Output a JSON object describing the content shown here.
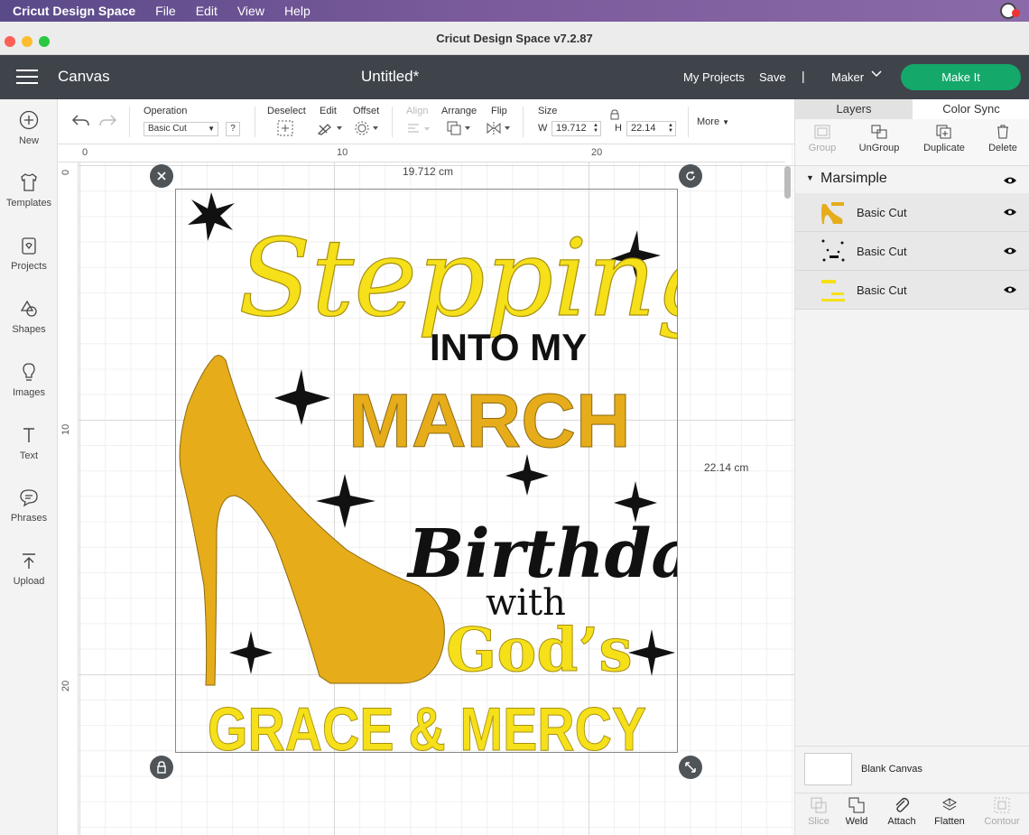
{
  "menubar": {
    "app_name": "Cricut Design Space",
    "items": [
      "File",
      "Edit",
      "View",
      "Help"
    ]
  },
  "window": {
    "title": "Cricut Design Space  v7.2.87"
  },
  "header": {
    "section": "Canvas",
    "doc_title": "Untitled*",
    "my_projects": "My Projects",
    "save": "Save",
    "separator": "|",
    "machine": "Maker",
    "make_it": "Make It"
  },
  "sidebar": {
    "items": [
      {
        "label": "New",
        "icon": "plus-circle-icon"
      },
      {
        "label": "Templates",
        "icon": "shirt-icon"
      },
      {
        "label": "Projects",
        "icon": "projects-icon"
      },
      {
        "label": "Shapes",
        "icon": "shapes-icon"
      },
      {
        "label": "Images",
        "icon": "lightbulb-icon"
      },
      {
        "label": "Text",
        "icon": "text-icon"
      },
      {
        "label": "Phrases",
        "icon": "speech-bubble-icon"
      },
      {
        "label": "Upload",
        "icon": "upload-icon"
      }
    ]
  },
  "toolbar": {
    "operation_label": "Operation",
    "operation_value": "Basic Cut",
    "help": "?",
    "deselect": "Deselect",
    "edit": "Edit",
    "offset": "Offset",
    "align": "Align",
    "arrange": "Arrange",
    "flip": "Flip",
    "size": "Size",
    "w_label": "W",
    "w_value": "19.712",
    "h_label": "H",
    "h_value": "22.14",
    "more": "More"
  },
  "rulers": {
    "h_ticks": [
      "0",
      "10",
      "20"
    ],
    "v_ticks": [
      "0",
      "10",
      "20"
    ]
  },
  "canvas": {
    "width_readout": "19.712 cm",
    "height_readout": "22.14 cm",
    "design_text": {
      "line1": "Stepping",
      "line2": "INTO MY",
      "line3": "MARCH",
      "line4": "Birthday",
      "line5": "with",
      "line6": "God’s",
      "line7": "GRACE & MERCY"
    },
    "colors": {
      "gold": "#e6ac1a",
      "yellow": "#f5e01a",
      "black": "#111111"
    }
  },
  "right_panel": {
    "tabs": [
      "Layers",
      "Color Sync"
    ],
    "actions": [
      "Group",
      "UnGroup",
      "Duplicate",
      "Delete"
    ],
    "group_name": "Marsimple",
    "layers": [
      {
        "label": "Basic Cut"
      },
      {
        "label": "Basic Cut"
      },
      {
        "label": "Basic Cut"
      }
    ],
    "blank_canvas": "Blank Canvas",
    "bottom_actions": [
      "Slice",
      "Weld",
      "Attach",
      "Flatten",
      "Contour"
    ]
  }
}
